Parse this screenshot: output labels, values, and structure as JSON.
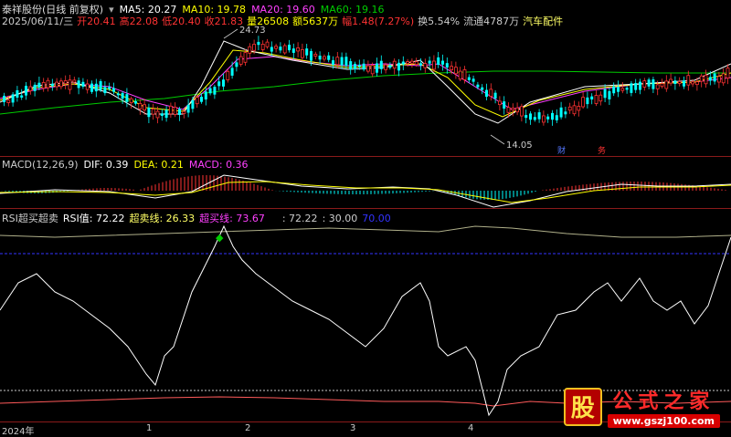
{
  "header": {
    "stock_name": "泰祥股份(日线 前复权)",
    "ma5": "MA5: 20.27",
    "ma10": "MA10: 19.78",
    "ma20": "MA20: 19.60",
    "ma60": "MA60: 19.16",
    "date": "2025/06/11/三",
    "open": "开20.41",
    "high": "高22.08",
    "low": "低20.40",
    "close": "收21.83",
    "volume": "量26508",
    "amount": "额5637万",
    "change": "幅1.48(7.27%)",
    "turnover": "换5.54%",
    "float": "流通4787万",
    "sector": "汽车配件"
  },
  "price_annotations": {
    "peak": "24.73",
    "trough": "14.05",
    "marker1": "财",
    "marker2": "务"
  },
  "macd": {
    "label": "MACD(12,26,9)",
    "dif": "DIF: 0.39",
    "dea": "DEA: 0.21",
    "macd": "MACD: 0.36"
  },
  "rsi": {
    "label": "RSI超买超卖",
    "rsi_value": "RSI值: 72.22",
    "oversold": "超卖线: 26.33",
    "overbought": "超买线: 73.67",
    "extra1": ": 72.22",
    "extra2": ": 30.00",
    "extra3": "70.00"
  },
  "x_axis": {
    "ticks": [
      "2024年",
      "1",
      "2",
      "3",
      "4"
    ]
  },
  "watermark": {
    "badge": "股",
    "name": "公式之家",
    "url": "www.gszj100.com"
  },
  "colors": {
    "ma5": "#ffffff",
    "ma10": "#ffff00",
    "ma20": "#ff40ff",
    "ma60": "#00cc00",
    "up": "#ff3333",
    "down": "#00ffff",
    "rsi_line": "#ffffff",
    "overbought": "#3333ff"
  }
}
